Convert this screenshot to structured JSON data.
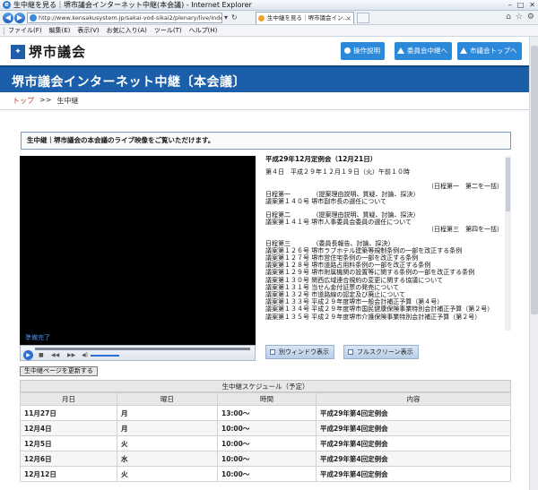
{
  "browser": {
    "window_title": "生中継を見る｜堺市議会インターネット中継(本会議) - Internet Explorer",
    "url": "http://www.kensakusystem.jp/sakai-vod-sikai2/plenary/live/inde",
    "tab_title": "生中継を見る｜堺市議会イン…",
    "menu": [
      "ファイル(F)",
      "編集(E)",
      "表示(V)",
      "お気に入り(A)",
      "ツール(T)",
      "ヘルプ(H)"
    ]
  },
  "header": {
    "site_name": "堺市議会",
    "buttons": [
      "操作説明",
      "委員会中継へ",
      "市議会トップへ"
    ]
  },
  "banner": {
    "title": "堺市議会インターネット中継〔本会議〕"
  },
  "breadcrumb": {
    "home": "トップ",
    "sep": ">>",
    "current": "生中継"
  },
  "notice": "生中継｜堺市議会の本会議のライブ映像をご覧いただけます。",
  "player": {
    "status": "準備完了",
    "refresh_label": "生中継ページを更新する"
  },
  "agenda": {
    "heading": "平成29年12月定例会（12月21日）",
    "date_line": "第４日　平成２９年１２月１９日（火）午前１０時",
    "blocks": [
      [
        "（日程第一　第二を一括）",
        "日程第一　　　　（提案理由説明、質疑、討論、採決）",
        "議案第１４０号 堺市副市長の選任について"
      ],
      [
        "日程第二　　　　（提案理由説明、質疑、討論、採決）",
        "議案第１４１号 堺市人事委員会委員の選任について",
        "（日程第三　第四を一括）"
      ],
      [
        "日程第三　　　　（委員長報告、討論、採決）",
        "議案第１２６号 堺市ラブホテル建築等規制条例の一部を改正する条例",
        "議案第１２７号 堺市営住宅条例の一部を改正する条例",
        "議案第１２８号 堺市道路占用料条例の一部を改正する条例",
        "議案第１２９号 堺市附属機関の設置等に関する条例の一部を改正する条例",
        "議案第１３０号 関西広域連合規約の変更に関する協議について",
        "議案第１３１号 当せん金付証票の発売について",
        "議案第１３２号 市道路線の認定及び廃止について",
        "議案第１３３号 平成２９年度堺市一般会計補正予算（第４号）",
        "議案第１３４号 平成２９年度堺市国民健康保険事業特別会計補正予算（第２号）",
        "議案第１３５号 平成２９年度堺市介護保険事業特別会計補正予算（第２号）"
      ]
    ]
  },
  "view_buttons": [
    "別ウィンドウ表示",
    "フルスクリーン表示"
  ],
  "schedule": {
    "caption": "生中継スケジュール（予定）",
    "headers": [
      "月日",
      "曜日",
      "時間",
      "内容"
    ],
    "rows": [
      [
        "11月27日",
        "月",
        "13:00～",
        "平成29年第4回定例会"
      ],
      [
        "12月4日",
        "月",
        "10:00～",
        "平成29年第4回定例会"
      ],
      [
        "12月5日",
        "火",
        "10:00～",
        "平成29年第4回定例会"
      ],
      [
        "12月6日",
        "水",
        "10:00～",
        "平成29年第4回定例会"
      ],
      [
        "12月12日",
        "火",
        "10:00～",
        "平成29年第4回定例会"
      ]
    ]
  },
  "colors": {
    "brand_blue": "#1b5ea9",
    "button_blue": "#2c88d9"
  }
}
